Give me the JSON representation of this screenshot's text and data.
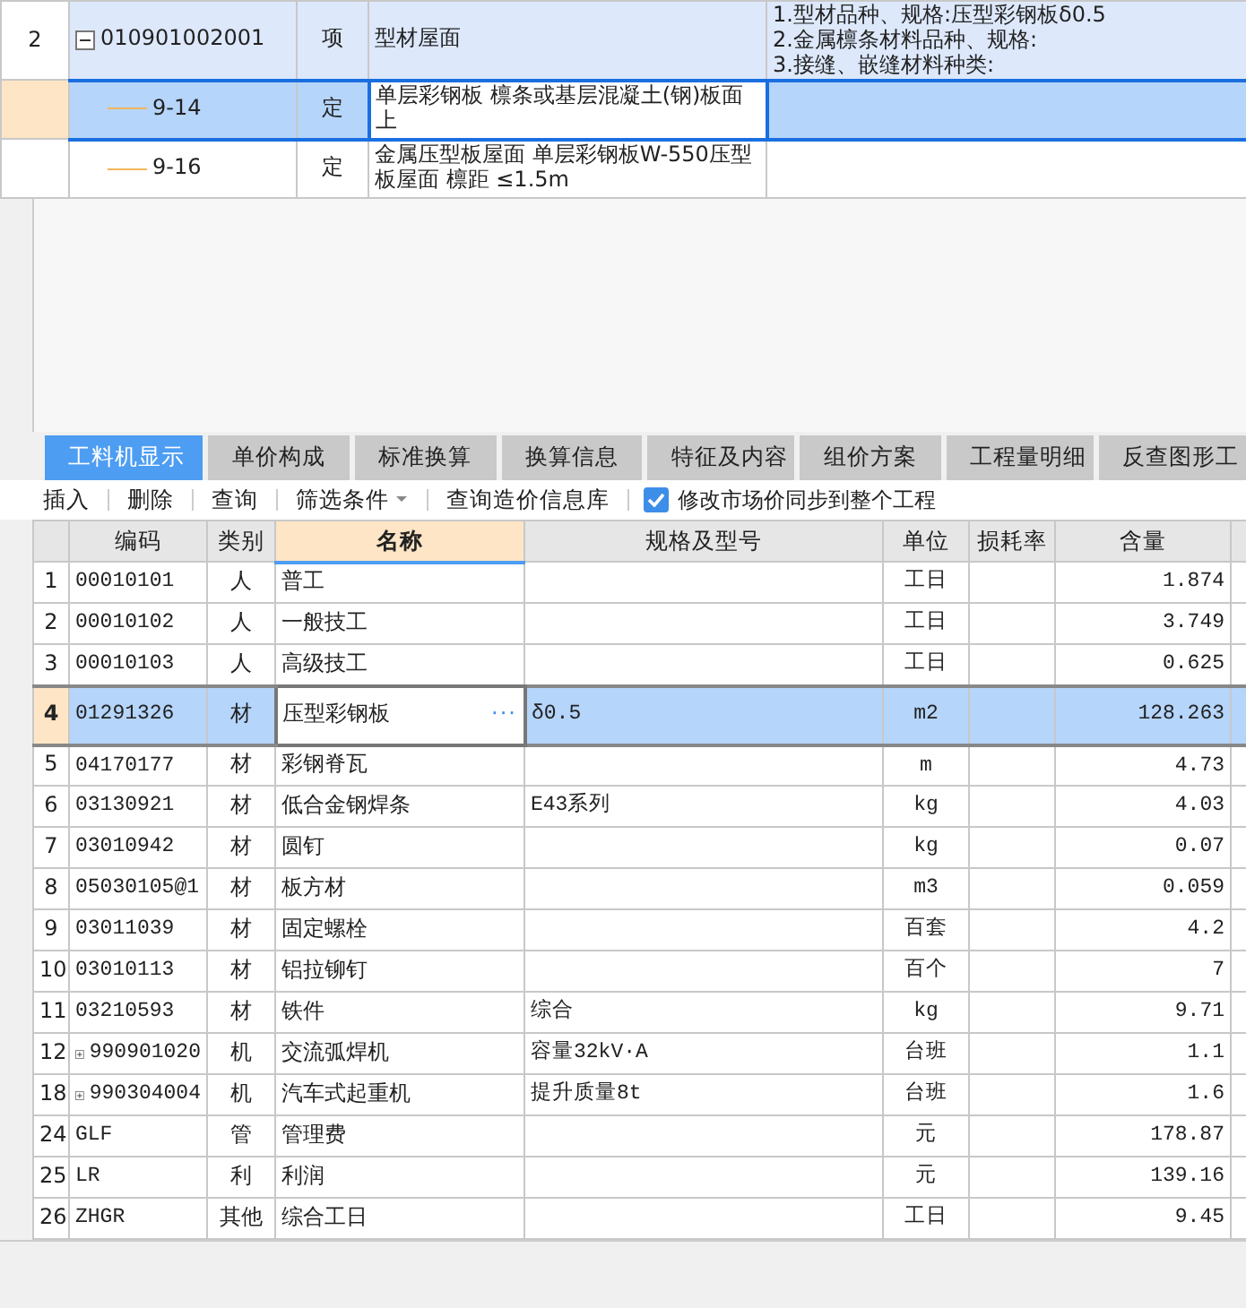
{
  "upper_table": {
    "rows": [
      {
        "row_number": "2",
        "code": "010901002001",
        "expanded": true,
        "type": "项",
        "name": "型材屋面",
        "description": [
          "1.型材品种、规格:压型彩钢板δ0.5",
          "2.金属檩条材料品种、规格:",
          "3.接缝、嵌缝材料种类:"
        ],
        "selected": false,
        "children": [
          {
            "code": "9-14",
            "type": "定",
            "name": "单层彩钢板 檩条或基层混凝土(钢)板面上",
            "selected": true
          },
          {
            "code": "9-16",
            "type": "定",
            "name": "金属压型板屋面 单层彩钢板W-550压型板屋面 檩距 ≤1.5m",
            "selected": false
          }
        ]
      }
    ]
  },
  "tabs": [
    {
      "label": "工料机显示",
      "selected": true
    },
    {
      "label": "单价构成",
      "selected": false
    },
    {
      "label": "标准换算",
      "selected": false
    },
    {
      "label": "换算信息",
      "selected": false
    },
    {
      "label": "特征及内容",
      "selected": false
    },
    {
      "label": "组价方案",
      "selected": false
    },
    {
      "label": "工程量明细",
      "selected": false
    },
    {
      "label": "反查图形工",
      "selected": false
    }
  ],
  "toolbar": [
    {
      "kind": "button",
      "label": "插入"
    },
    {
      "kind": "button",
      "label": "删除"
    },
    {
      "kind": "button",
      "label": "查询"
    },
    {
      "kind": "dropdown",
      "label": "筛选条件"
    },
    {
      "kind": "button",
      "label": "查询造价信息库"
    },
    {
      "kind": "checkbox",
      "label": "修改市场价同步到整个工程",
      "checked": true
    }
  ],
  "lower_table": {
    "columns": [
      {
        "label": "编码",
        "selected": false
      },
      {
        "label": "类别",
        "selected": false
      },
      {
        "label": "名称",
        "selected": true
      },
      {
        "label": "规格及型号",
        "selected": false
      },
      {
        "label": "单位",
        "selected": false
      },
      {
        "label": "损耗率",
        "selected": false
      },
      {
        "label": "含量",
        "selected": false
      }
    ],
    "rows": [
      {
        "row_number": "1",
        "kind": "item",
        "code": "00010101",
        "type": "人",
        "name": "普工",
        "spec": "",
        "unit": "工日",
        "quantity": "1.874",
        "selected": false
      },
      {
        "row_number": "2",
        "kind": "item",
        "code": "00010102",
        "type": "人",
        "name": "一般技工",
        "spec": "",
        "unit": "工日",
        "quantity": "3.749",
        "selected": false
      },
      {
        "row_number": "3",
        "kind": "item",
        "code": "00010103",
        "type": "人",
        "name": "高级技工",
        "spec": "",
        "unit": "工日",
        "quantity": "0.625",
        "selected": false
      },
      {
        "row_number": "4",
        "kind": "item",
        "code": "01291326",
        "type": "材",
        "name": "压型彩钢板",
        "edit_button": "···",
        "spec": "δ0.5",
        "unit": "m2",
        "quantity": "128.263",
        "selected": true
      },
      {
        "row_number": "5",
        "kind": "item",
        "code": "04170177",
        "type": "材",
        "name": "彩钢脊瓦",
        "spec": "",
        "unit": "m",
        "quantity": "4.73",
        "selected": false
      },
      {
        "row_number": "6",
        "kind": "item",
        "code": "03130921",
        "type": "材",
        "name": "低合金钢焊条",
        "spec": "E43系列",
        "unit": "kg",
        "quantity": "4.03",
        "selected": false
      },
      {
        "row_number": "7",
        "kind": "item",
        "code": "03010942",
        "type": "材",
        "name": "圆钉",
        "spec": "",
        "unit": "kg",
        "quantity": "0.07",
        "selected": false
      },
      {
        "row_number": "8",
        "kind": "item",
        "code": "05030105@1",
        "type": "材",
        "name": "板方材",
        "spec": "",
        "unit": "m3",
        "quantity": "0.059",
        "selected": false
      },
      {
        "row_number": "9",
        "kind": "item",
        "code": "03011039",
        "type": "材",
        "name": "固定螺栓",
        "spec": "",
        "unit": "百套",
        "quantity": "4.2",
        "selected": false
      },
      {
        "row_number": "10",
        "kind": "item",
        "code": "03010113",
        "type": "材",
        "name": "铝拉铆钉",
        "spec": "",
        "unit": "百个",
        "quantity": "7",
        "selected": false
      },
      {
        "row_number": "11",
        "kind": "item",
        "code": "03210593",
        "type": "材",
        "name": "铁件",
        "spec": "综合",
        "unit": "kg",
        "quantity": "9.71",
        "selected": false
      },
      {
        "row_number": "12",
        "kind": "group",
        "code": "990901020",
        "type": "机",
        "name": "交流弧焊机",
        "spec": "容量32kV·A",
        "unit": "台班",
        "quantity": "1.1",
        "selected": false
      },
      {
        "row_number": "18",
        "kind": "group",
        "code": "990304004",
        "type": "机",
        "name": "汽车式起重机",
        "spec": "提升质量8t",
        "unit": "台班",
        "quantity": "1.6",
        "selected": false
      },
      {
        "row_number": "24",
        "kind": "item",
        "code": "GLF",
        "type": "管",
        "name": "管理费",
        "spec": "",
        "unit": "元",
        "quantity": "178.87",
        "selected": false
      },
      {
        "row_number": "25",
        "kind": "item",
        "code": "LR",
        "type": "利",
        "name": "利润",
        "spec": "",
        "unit": "元",
        "quantity": "139.16",
        "selected": false
      },
      {
        "row_number": "26",
        "kind": "item",
        "code": "ZHGR",
        "type": "其他",
        "name": "综合工日",
        "spec": "",
        "unit": "工日",
        "quantity": "9.45",
        "selected": false
      }
    ]
  }
}
